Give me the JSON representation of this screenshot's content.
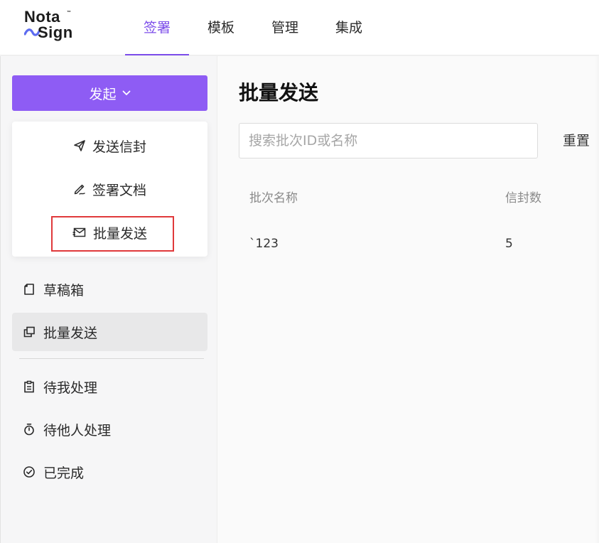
{
  "brand": {
    "logo_top": "Nota",
    "logo_bottom": "Sign",
    "logo_tm": "™",
    "accent": "#7c4dea"
  },
  "nav": {
    "tabs": [
      {
        "label": "签署",
        "active": true
      },
      {
        "label": "模板"
      },
      {
        "label": "管理"
      },
      {
        "label": "集成"
      }
    ]
  },
  "sidebar": {
    "start_button": {
      "label": "发起",
      "color": "#8e5cf4",
      "icon": "chevron-down-icon"
    },
    "dropdown": [
      {
        "label": "发送信封",
        "icon": "send-icon"
      },
      {
        "label": "签署文档",
        "icon": "pen-icon"
      },
      {
        "label": "批量发送",
        "icon": "bulk-mail-icon",
        "highlighted": true
      }
    ],
    "items": [
      {
        "label": "草稿箱",
        "icon": "draft-icon"
      },
      {
        "label": "批量发送",
        "icon": "copy-icon",
        "active": true
      },
      {
        "label": "待我处理",
        "icon": "clipboard-icon"
      },
      {
        "label": "待他人处理",
        "icon": "timer-icon"
      },
      {
        "label": "已完成",
        "icon": "check-circle-icon"
      }
    ]
  },
  "main": {
    "title": "批量发送",
    "search": {
      "placeholder": "搜索批次ID或名称",
      "value": ""
    },
    "reset_label": "重置",
    "table": {
      "columns": [
        "批次名称",
        "信封数"
      ],
      "rows": [
        [
          "`123",
          "5"
        ]
      ]
    }
  }
}
